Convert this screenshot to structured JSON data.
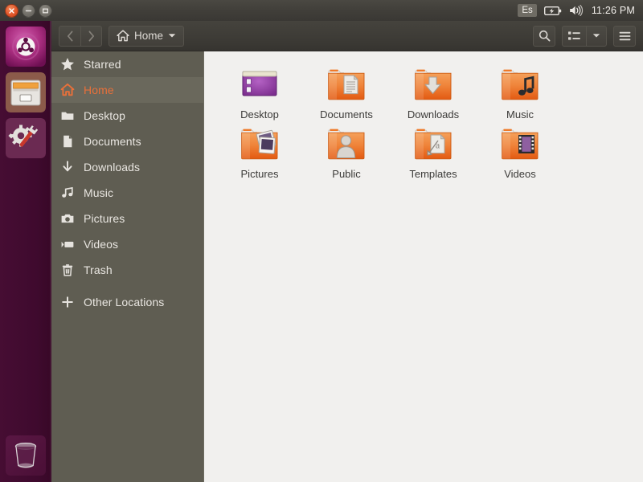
{
  "panel": {
    "window_controls": [
      {
        "name": "close",
        "glyph": "×"
      },
      {
        "name": "minimize",
        "glyph": "−"
      },
      {
        "name": "maximize",
        "glyph": "□"
      }
    ],
    "tray": {
      "keyboard_layout": "Es",
      "battery_icon": "battery-charging-icon",
      "volume_icon": "volume-icon",
      "clock": "11:26 PM"
    }
  },
  "launcher": {
    "items": [
      {
        "name": "ubuntu-dash",
        "label": "Ubuntu",
        "active": false
      },
      {
        "name": "files",
        "label": "Files",
        "active": true
      },
      {
        "name": "system-settings",
        "label": "System Settings",
        "active": false
      }
    ],
    "trash": {
      "name": "trash",
      "label": "Trash"
    }
  },
  "headerbar": {
    "back_label": "‹",
    "forward_label": "›",
    "path_label": "Home",
    "path_icon": "home-icon",
    "search_icon": "search-icon",
    "view_icon": "list-view-icon",
    "view_dropdown_icon": "chevron-down-icon",
    "menu_icon": "hamburger-menu-icon"
  },
  "sidebar": {
    "items": [
      {
        "label": "Starred",
        "icon": "star-icon",
        "selected": false
      },
      {
        "label": "Home",
        "icon": "home-icon",
        "selected": true
      },
      {
        "label": "Desktop",
        "icon": "folder-icon",
        "selected": false
      },
      {
        "label": "Documents",
        "icon": "document-icon",
        "selected": false
      },
      {
        "label": "Downloads",
        "icon": "download-icon",
        "selected": false
      },
      {
        "label": "Music",
        "icon": "music-icon",
        "selected": false
      },
      {
        "label": "Pictures",
        "icon": "camera-icon",
        "selected": false
      },
      {
        "label": "Videos",
        "icon": "video-icon",
        "selected": false
      },
      {
        "label": "Trash",
        "icon": "trash-icon",
        "selected": false
      },
      {
        "label": "Other Locations",
        "icon": "plus-icon",
        "selected": false
      }
    ]
  },
  "content": {
    "files": [
      {
        "name": "Desktop",
        "icon": "desktop-folder-icon"
      },
      {
        "name": "Documents",
        "icon": "documents-folder-icon"
      },
      {
        "name": "Downloads",
        "icon": "downloads-folder-icon"
      },
      {
        "name": "Music",
        "icon": "music-folder-icon"
      },
      {
        "name": "Pictures",
        "icon": "pictures-folder-icon"
      },
      {
        "name": "Public",
        "icon": "public-folder-icon"
      },
      {
        "name": "Templates",
        "icon": "templates-folder-icon"
      },
      {
        "name": "Videos",
        "icon": "videos-folder-icon"
      }
    ]
  },
  "colors": {
    "accent_orange": "#e8703a",
    "sidebar_bg": "#5f5d52",
    "content_bg": "#f1f0ee",
    "panel_bg": "#403e39",
    "launcher_bg": "#3f0a2e"
  }
}
